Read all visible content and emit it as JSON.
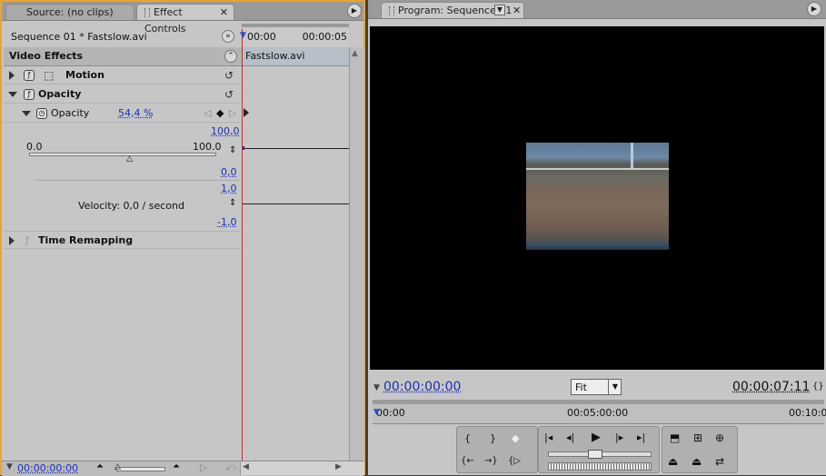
{
  "left": {
    "tabs": [
      {
        "label": "Source: (no clips)"
      },
      {
        "label": "Effect Controls"
      }
    ],
    "sequence_label": "Sequence 01 * Fastslow.avi",
    "ruler": {
      "start": "00:00",
      "end": "00:00:05"
    },
    "clip_name": "Fastslow.avi",
    "video_effects_header": "Video Effects",
    "effects": [
      {
        "name": "Motion"
      },
      {
        "name": "Opacity"
      },
      {
        "name": "Time Remapping"
      }
    ],
    "opacity_param": {
      "label": "Opacity",
      "value": "54,4 %",
      "graph_max": "100,0",
      "slider_min": "0.0",
      "slider_max": "100.0",
      "slider_level": 0.544,
      "graph_min": "0,0",
      "velocity_max": "1,0",
      "velocity_text": "Velocity: 0,0 / second",
      "velocity_min": "-1,0"
    },
    "timecode": "00:00:00:00"
  },
  "right": {
    "tab_label": "Program: Sequence 01",
    "timecode": "00:00:00:00",
    "zoom": "Fit",
    "duration": "00:00:07:11",
    "ruler": {
      "start": "00:00",
      "mid": "00:05:00:00",
      "end": "00:10:0"
    }
  },
  "icons": {
    "close": "close-icon",
    "menu": "panel-menu-icon",
    "reset": "reset-icon",
    "play": "play-icon"
  },
  "colors": {
    "active_border": "#e4a53b",
    "playhead": "#c3302b",
    "link": "#1b2fb8"
  }
}
